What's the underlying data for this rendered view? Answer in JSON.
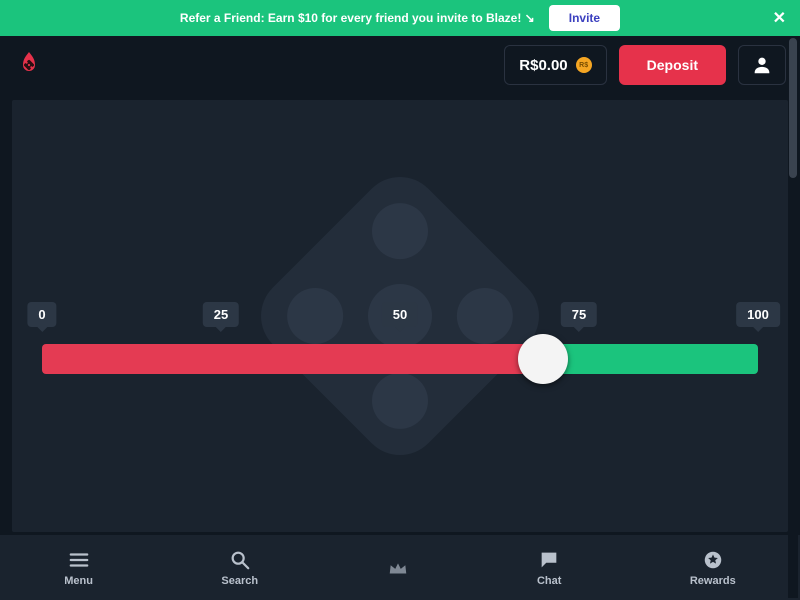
{
  "colors": {
    "accent_green": "#1bc47d",
    "accent_red": "#e6324b",
    "slider_red": "#e43b53"
  },
  "referral": {
    "text": "Refer a Friend: Earn $10 for every friend you invite to Blaze! ↘",
    "invite_label": "Invite"
  },
  "header": {
    "balance": "R$0.00",
    "coin_label": "R$",
    "deposit_label": "Deposit"
  },
  "slider": {
    "marks": [
      "0",
      "25",
      "50",
      "75",
      "100"
    ],
    "value": 70
  },
  "nav": {
    "menu": "Menu",
    "search": "Search",
    "chat": "Chat",
    "rewards": "Rewards"
  }
}
